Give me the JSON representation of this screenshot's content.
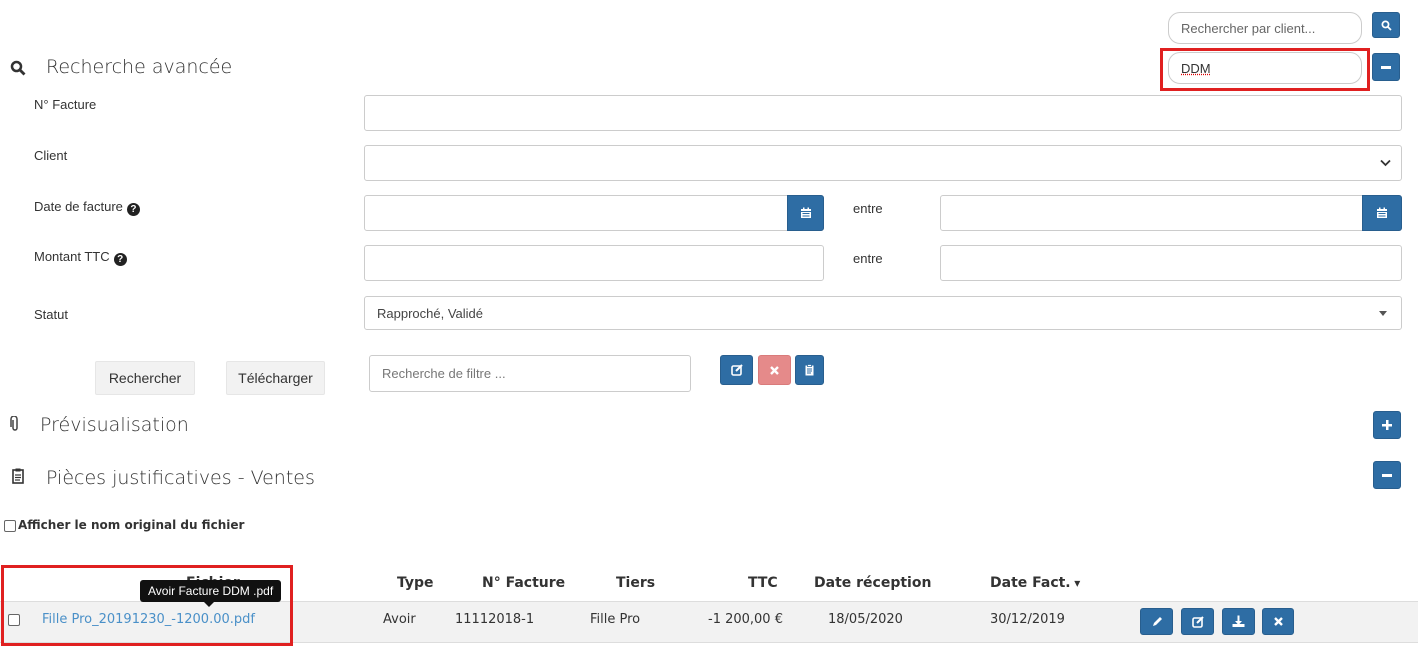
{
  "top_search": {
    "placeholder": "Rechercher par client..."
  },
  "active_filter": {
    "value": "DDM"
  },
  "advanced_search": {
    "title": "Recherche avancée",
    "fields": {
      "invoice_number": {
        "label": "N° Facture",
        "value": ""
      },
      "client": {
        "label": "Client",
        "value": ""
      },
      "invoice_date": {
        "label": "Date de facture",
        "between": "entre"
      },
      "amount": {
        "label": "Montant TTC",
        "between": "entre"
      },
      "status": {
        "label": "Statut",
        "value": "Rapproché, Validé"
      }
    },
    "search_button": "Rechercher",
    "download_button": "Télécharger",
    "filter_search_placeholder": "Recherche de filtre ..."
  },
  "preview": {
    "title": "Prévisualisation"
  },
  "documents": {
    "title": "Pièces justificatives - Ventes"
  },
  "show_original_name": {
    "label": "Afficher le nom original du fichier"
  },
  "table": {
    "columns": [
      "Fichier",
      "Type",
      "N° Facture",
      "Tiers",
      "TTC",
      "Date réception",
      "Date Fact."
    ],
    "sort_indicator": "▾",
    "tooltip": "Avoir Facture DDM .pdf",
    "rows": [
      {
        "file": "Fille Pro_20191230_-1200.00.pdf",
        "type": "Avoir",
        "invoice_number": "11112018-1",
        "third_party": "Fille Pro",
        "amount": "-1 200,00 €",
        "received_date": "18/05/2020",
        "invoice_date": "30/12/2019"
      }
    ]
  },
  "colors": {
    "primary": "#2e6da4",
    "danger_light": "#e58a8a",
    "highlight": "#e02020",
    "link": "#4a90c8"
  }
}
